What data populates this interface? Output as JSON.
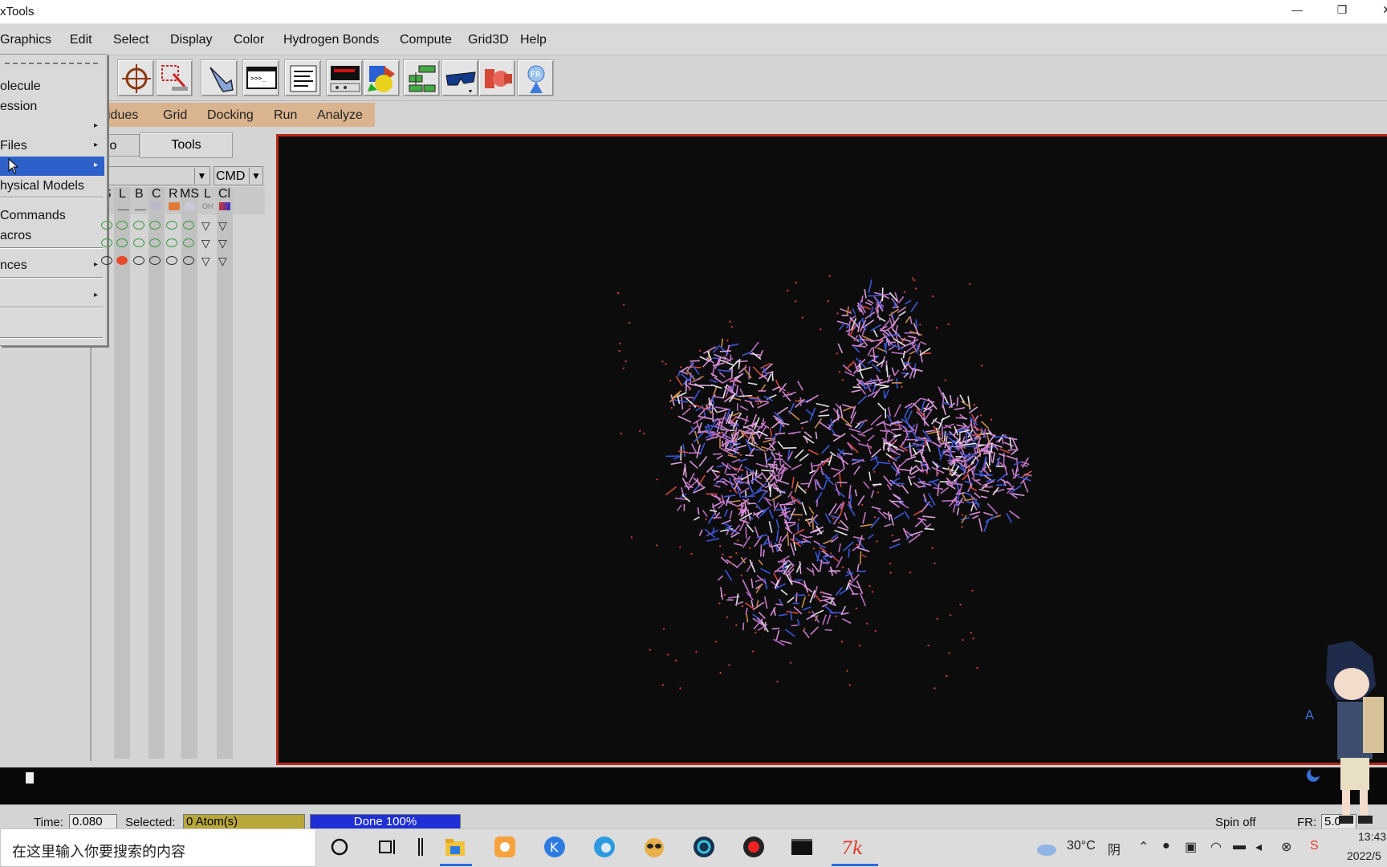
{
  "window": {
    "title": "xTools",
    "minimize": "—",
    "restore": "❐",
    "close": "✕"
  },
  "menubar": {
    "items": [
      "Graphics",
      "Edit",
      "Select",
      "Display",
      "Color",
      "Hydrogen Bonds",
      "Compute",
      "Grid3D",
      "Help"
    ]
  },
  "toolbar": {
    "icons": [
      "pencil-icon",
      "crosshair-icon",
      "select-box-icon",
      "pointing-hand-icon",
      "python-shell-icon",
      "text-editor-icon",
      "measure-panel-icon",
      "sphere-cube-icon",
      "hierarchy-icon",
      "stereo-glasses-icon",
      "shapes-icon",
      "fr-icon"
    ]
  },
  "adt_menu": {
    "items": [
      "sidues",
      "Grid",
      "Docking",
      "Run",
      "Analyze"
    ]
  },
  "dashboard": {
    "tab_pmv": "io",
    "tab_tools": "Tools",
    "selector_arrow": "▼",
    "cmd_label": "CMD",
    "cmd_arrow": "▼",
    "columns": [
      "S",
      "L",
      "B",
      "C",
      "R",
      "MS",
      "L",
      "Cl"
    ],
    "rows": [
      {
        "states": [
          "green",
          "green",
          "green",
          "green",
          "green",
          "green",
          "tri",
          "tri"
        ]
      },
      {
        "states": [
          "green",
          "green",
          "green",
          "green",
          "green",
          "green",
          "tri",
          "tri"
        ]
      },
      {
        "states": [
          "black",
          "red",
          "black",
          "black",
          "black",
          "black",
          "tri",
          "tri"
        ]
      }
    ]
  },
  "file_menu": {
    "items": [
      {
        "label": "olecule",
        "submenu": false
      },
      {
        "label": "ession",
        "submenu": false
      },
      {
        "label": "",
        "submenu": true
      },
      {
        "label": "Files",
        "submenu": true
      },
      {
        "label": "",
        "submenu": true,
        "active": true
      },
      {
        "label": "hysical Models",
        "submenu": false
      },
      {
        "label": "Commands",
        "submenu": false
      },
      {
        "label": "acros",
        "submenu": false
      },
      {
        "label": "nces",
        "submenu": true
      },
      {
        "label": "",
        "submenu": true
      },
      {
        "label": "",
        "submenu": false
      }
    ],
    "submenu_arrow": "▸"
  },
  "statusbar": {
    "time_label": "Time:",
    "time_value": "0.080",
    "selected_label": "Selected:",
    "selected_value": "0 Atom(s)",
    "progress_text": "Done 100%",
    "progress": 1.0,
    "spin_label": "Spin off",
    "fr_label": "FR:",
    "fr_value": "5.0"
  },
  "taskbar": {
    "search_placeholder": "在这里输入你要搜索的内容",
    "weather_temp": "30°C",
    "weather_text": "阴",
    "clock_time": "13:43",
    "clock_date": "2022/5"
  },
  "colors": {
    "adt_menu_bg": "#d9b48f",
    "menu_highlight": "#2d61c9",
    "viewer_border": "#b82818",
    "selected_field_bg": "#b8a83a",
    "progress_bg": "#1f2fd6"
  }
}
